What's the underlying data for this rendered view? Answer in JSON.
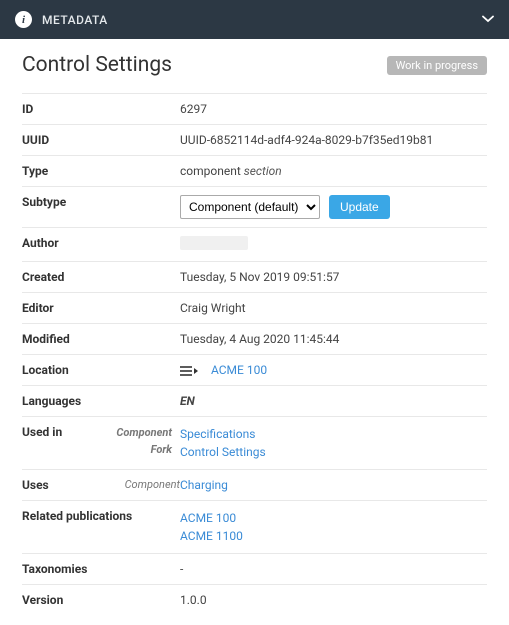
{
  "header": {
    "title": "METADATA"
  },
  "page": {
    "title": "Control Settings",
    "badge": "Work in progress"
  },
  "fields": {
    "id": {
      "label": "ID",
      "value": "6297"
    },
    "uuid": {
      "label": "UUID",
      "value": "UUID-6852114d-adf4-924a-8029-b7f35ed19b81"
    },
    "type": {
      "label": "Type",
      "prefix": "component ",
      "suffix": "section"
    },
    "subtype": {
      "label": "Subtype",
      "selected": "Component (default)",
      "button": "Update"
    },
    "author": {
      "label": "Author",
      "value": ""
    },
    "created": {
      "label": "Created",
      "value": "Tuesday, 5 Nov 2019 09:51:57"
    },
    "editor": {
      "label": "Editor",
      "value": "Craig Wright"
    },
    "modified": {
      "label": "Modified",
      "value": "Tuesday, 4 Aug 2020 11:45:44"
    },
    "location": {
      "label": "Location",
      "link": "ACME 100"
    },
    "languages": {
      "label": "Languages",
      "value": "EN"
    },
    "used_in": {
      "label": "Used in",
      "sub1": "Component",
      "sub2": "Fork",
      "link1": "Specifications",
      "link2": "Control Settings"
    },
    "uses": {
      "label": "Uses",
      "sub": "Component",
      "link": "Charging"
    },
    "related": {
      "label": "Related publications",
      "link1": "ACME 100",
      "link2": "ACME 1100"
    },
    "taxonomies": {
      "label": "Taxonomies",
      "value": "-"
    },
    "version": {
      "label": "Version",
      "value": "1.0.0"
    }
  }
}
